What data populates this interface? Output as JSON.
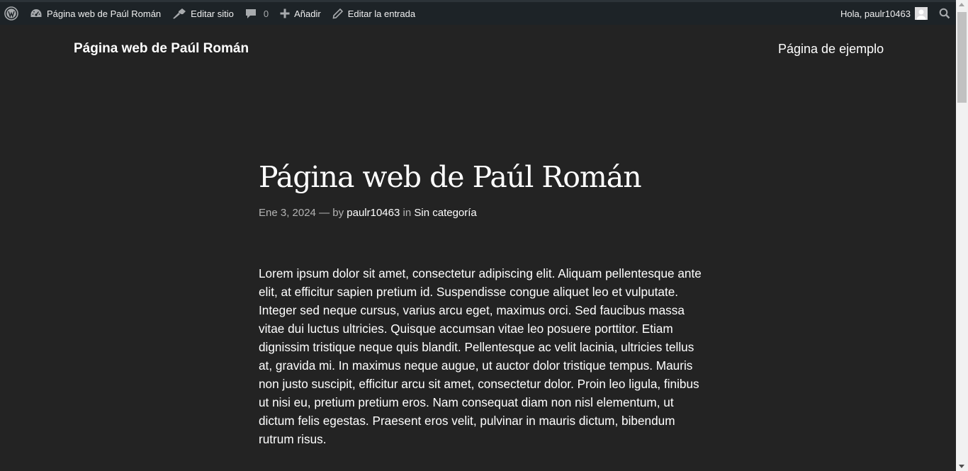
{
  "admin_bar": {
    "site_name": "Página web de Paúl Román",
    "edit_site": "Editar sitio",
    "comments_count": "0",
    "add_new": "Añadir",
    "edit_post": "Editar la entrada",
    "greeting": "Hola, paulr10463"
  },
  "header": {
    "site_title": "Página web de Paúl Román",
    "nav_item": "Página de ejemplo"
  },
  "post": {
    "title": "Página web de Paúl Román",
    "date": "Ene 3, 2024",
    "by_text": "— by",
    "author": "paulr10463",
    "in_text": "in",
    "category": "Sin categoría",
    "body": "Lorem ipsum dolor sit amet, consectetur adipiscing elit. Aliquam pellentesque ante elit, at efficitur sapien pretium id. Suspendisse congue aliquet leo et vulputate. Integer sed neque cursus, varius arcu eget, maximus orci. Sed faucibus massa vitae dui luctus ultricies. Quisque accumsan vitae leo posuere porttitor. Etiam dignissim tristique neque quis blandit. Pellentesque ac velit lacinia, ultricies tellus at, gravida mi. In maximus neque augue, ut auctor dolor tristique tempus. Mauris non justo suscipit, efficitur arcu sit amet, consectetur dolor. Proin leo ligula, finibus ut nisi eu, pretium pretium eros. Nam consequat diam non nisl elementum, ut dictum felis egestas. Praesent eros velit, pulvinar in mauris dictum, bibendum rutrum risus."
  },
  "icons": {
    "wordpress": "wordpress-logo-icon",
    "dashboard": "dashboard-icon",
    "customize": "brush-icon",
    "comments": "comment-icon",
    "add": "plus-icon",
    "edit": "pencil-icon",
    "search": "search-icon"
  },
  "colors": {
    "admin_bar_bg": "#1d2327",
    "page_bg": "#232323",
    "text": "#ffffff",
    "meta_text": "#b3b3b3"
  }
}
